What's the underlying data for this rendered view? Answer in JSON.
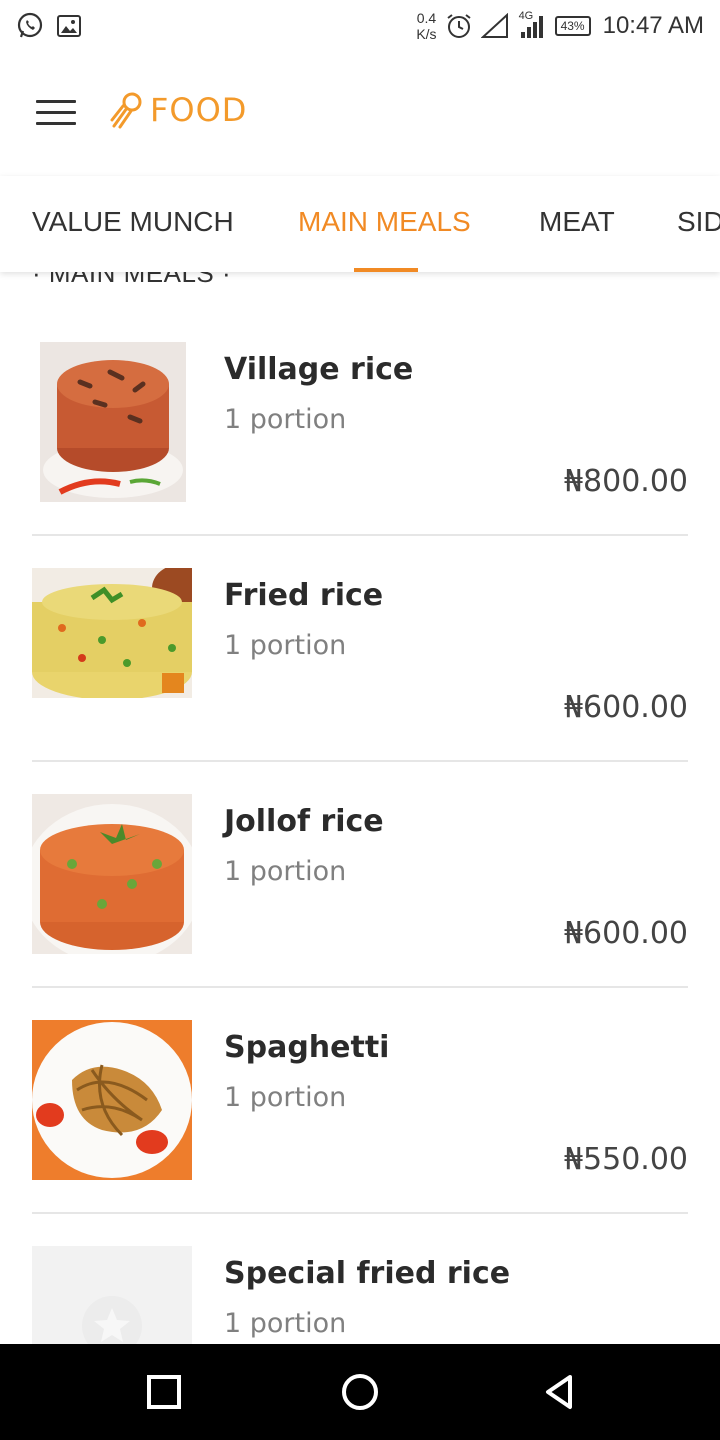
{
  "status_bar": {
    "net_speed_value": "0.4",
    "net_speed_unit": "K/s",
    "network_type": "4G",
    "battery": "43%",
    "time": "10:47 AM"
  },
  "header": {
    "logo_text": "FOOD",
    "brand_color": "#f39a2b"
  },
  "tabs": [
    {
      "label": "VALUE MUNCH",
      "active": false
    },
    {
      "label": "MAIN MEALS",
      "active": true
    },
    {
      "label": "MEAT",
      "active": false
    },
    {
      "label": "SID",
      "active": false
    }
  ],
  "section_heading": "· MAIN MEALS ·",
  "meals": [
    {
      "name": "Village rice",
      "portion": "1 portion",
      "price": "₦800.00",
      "image": "village-rice-photo"
    },
    {
      "name": "Fried rice",
      "portion": "1 portion",
      "price": "₦600.00",
      "image": "fried-rice-photo"
    },
    {
      "name": "Jollof rice",
      "portion": "1 portion",
      "price": "₦600.00",
      "image": "jollof-rice-photo"
    },
    {
      "name": "Spaghetti",
      "portion": "1 portion",
      "price": "₦550.00",
      "image": "spaghetti-photo"
    },
    {
      "name": "Special fried rice",
      "portion": "1 portion",
      "price": "",
      "image": "placeholder-image"
    }
  ],
  "nav_bar": {
    "recents_icon": "square-icon",
    "home_icon": "circle-icon",
    "back_icon": "triangle-back-icon"
  }
}
